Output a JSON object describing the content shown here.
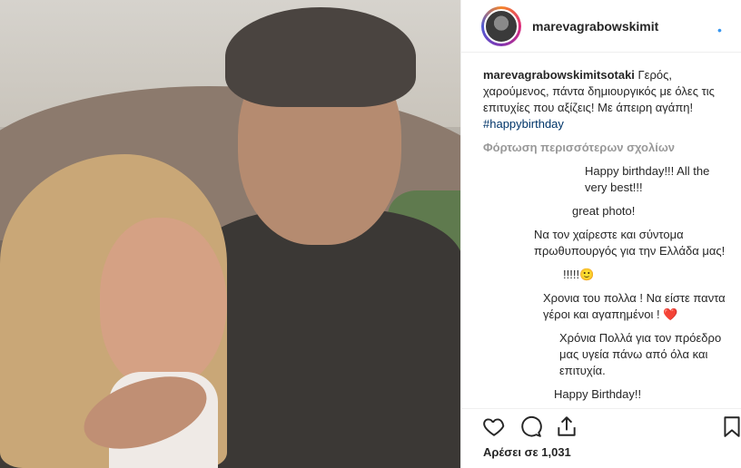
{
  "post": {
    "username": "marevagrabowskimit",
    "caption_username": "marevagrabowskimitsotaki",
    "caption_text": " Γερός, χαρούμενος, πάντα δημιουργικός με όλες τις επιτυχίες που αξίζεις! Με άπειρη αγάπη! ",
    "caption_hashtag": "#happybirthday",
    "load_more": "Φόρτωση περισσότερων σχολίων",
    "comments": [
      {
        "text": "Happy birthday!!! All the very best!!!"
      },
      {
        "text": "great photo!"
      },
      {
        "text": "Να τον χαίρεστε και σύντομα πρωθυπουργός για την Ελλάδα μας!"
      },
      {
        "text": "!!!!!🙂"
      },
      {
        "text": "Χρονια του πολλα ! Να είστε παντα γέροι και αγαπημένοι ! ❤️"
      },
      {
        "text": "Χρόνια Πολλά για τον πρόεδρο μας υγεία πάνω από όλα και επιτυχία."
      },
      {
        "text": "Happy Birthday!!"
      }
    ],
    "likes": "Αρέσει σε 1,031"
  },
  "colors": {
    "accent_link": "#003569",
    "muted": "#999999",
    "text": "#262626"
  },
  "icons": [
    "heart-icon",
    "comment-icon",
    "share-icon",
    "bookmark-icon"
  ]
}
